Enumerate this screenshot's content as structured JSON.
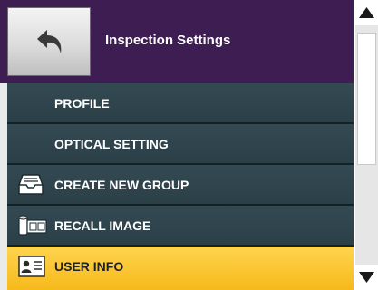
{
  "header": {
    "title": "Inspection Settings",
    "back_icon": "back-arrow-icon"
  },
  "menu": {
    "items": [
      {
        "label": "PROFILE",
        "icon": ""
      },
      {
        "label": "OPTICAL SETTING",
        "icon": ""
      },
      {
        "label": "CREATE NEW GROUP",
        "icon": "inbox-tray-icon"
      },
      {
        "label": "RECALL IMAGE",
        "icon": "film-roll-icon"
      },
      {
        "label": "USER INFO",
        "icon": "id-card-icon",
        "selected": true
      }
    ]
  },
  "colors": {
    "header_bg": "#3e1d52",
    "item_bg": "#2f434b",
    "selected_bg": "#f8c22e"
  }
}
